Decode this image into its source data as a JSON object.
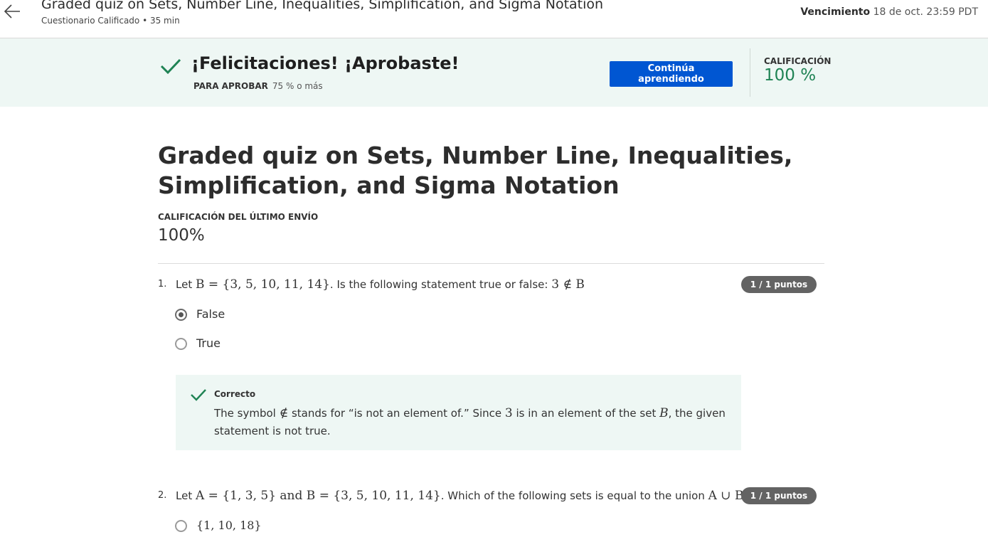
{
  "header": {
    "title": "Graded quiz on Sets, Number Line, Inequalities, Simplification, and Sigma Notation",
    "subtitle": "Cuestionario Calificado • 35 min",
    "due_label": "Vencimiento",
    "due_value": "18 de oct. 23:59 PDT",
    "back_icon": "arrow-left-icon"
  },
  "banner": {
    "message": "¡Felicitaciones! ¡Aprobaste!",
    "pass_label": "PARA APROBAR",
    "pass_value": "75 % o más",
    "button_label": "Continúa aprendiendo",
    "grade_label": "CALIFICACIÓN",
    "grade_value": "100 %",
    "check_icon": "check-icon",
    "colors": {
      "accent": "#1f8354",
      "button": "#0056d2",
      "banner_bg": "#eef7f4"
    }
  },
  "main": {
    "title": "Graded quiz on Sets, Number Line, Inequalities, Simplification, and Sigma Notation",
    "last_label": "CALIFICACIÓN DEL ÚLTIMO ENVÍO",
    "last_value": "100%"
  },
  "questions": [
    {
      "number": "1.",
      "text_prefix": "Let ",
      "math_1": "B = {3, 5, 10, 11, 14}",
      "text_middle": ". Is the following statement true or false: ",
      "math_2": "3 ∉ B",
      "text_suffix": "",
      "points": "1 / 1 puntos",
      "options": [
        {
          "label": "False",
          "selected": true
        },
        {
          "label": "True",
          "selected": false
        }
      ],
      "feedback": {
        "title": "Correcto",
        "text_1": "The symbol ",
        "math_a": "∉",
        "text_2": " stands for “is not an element of.” Since ",
        "math_b": "3",
        "text_3": " is in an element of the set ",
        "math_c": "B",
        "text_4": ", the given statement is not true."
      }
    },
    {
      "number": "2.",
      "text_prefix": "Let ",
      "math_1": "A = {1, 3, 5}",
      "text_and": " and ",
      "math_2": "B = {3, 5, 10, 11, 14}",
      "text_middle": ". Which of the following sets is equal to the union ",
      "math_3": "A ∪ B",
      "text_suffix": "?",
      "points": "1 / 1 puntos",
      "options": [
        {
          "label": "{1, 10, 18}",
          "selected": false
        }
      ]
    }
  ]
}
